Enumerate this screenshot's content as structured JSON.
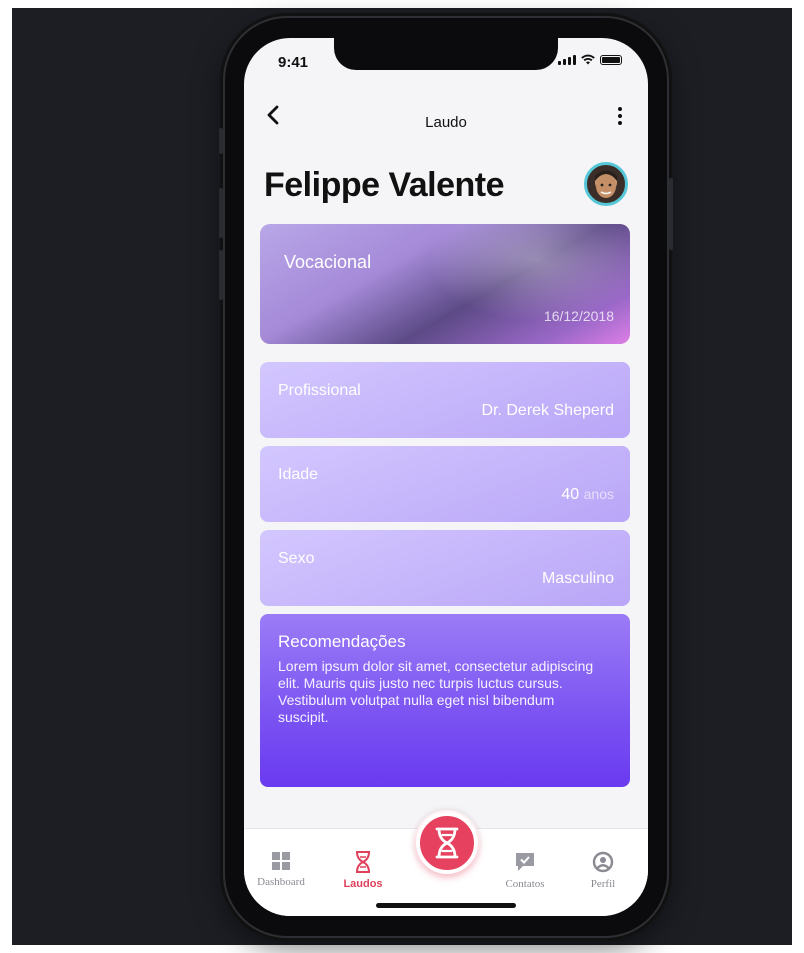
{
  "status": {
    "time": "9:41"
  },
  "header": {
    "title": "Laudo"
  },
  "patient": {
    "name": "Felippe Valente"
  },
  "exam": {
    "title": "Vocacional",
    "date": "16/12/2018"
  },
  "details": [
    {
      "label": "Profissional",
      "value": "Dr. Derek Sheperd",
      "unit": ""
    },
    {
      "label": "Idade",
      "value": "40",
      "unit": "anos"
    },
    {
      "label": "Sexo",
      "value": "Masculino",
      "unit": ""
    }
  ],
  "recommendations": {
    "title": "Recomendações",
    "text": "Lorem ipsum dolor sit amet, consectetur adipiscing elit. Mauris quis justo nec turpis luctus cursus. Vestibulum volutpat nulla eget nisl bibendum suscipit."
  },
  "tabs": [
    {
      "label": "Dashboard",
      "icon": "grid-icon"
    },
    {
      "label": "Laudos",
      "icon": "hourglass-dna-icon",
      "active": true
    },
    {
      "label": "Contatos",
      "icon": "chat-check-icon"
    },
    {
      "label": "Perfil",
      "icon": "user-circle-icon"
    }
  ],
  "colors": {
    "accent": "#e6425f",
    "card_light": "#c4b4fb",
    "card_dark": "#7a52f2",
    "background": "#1c1e24"
  }
}
